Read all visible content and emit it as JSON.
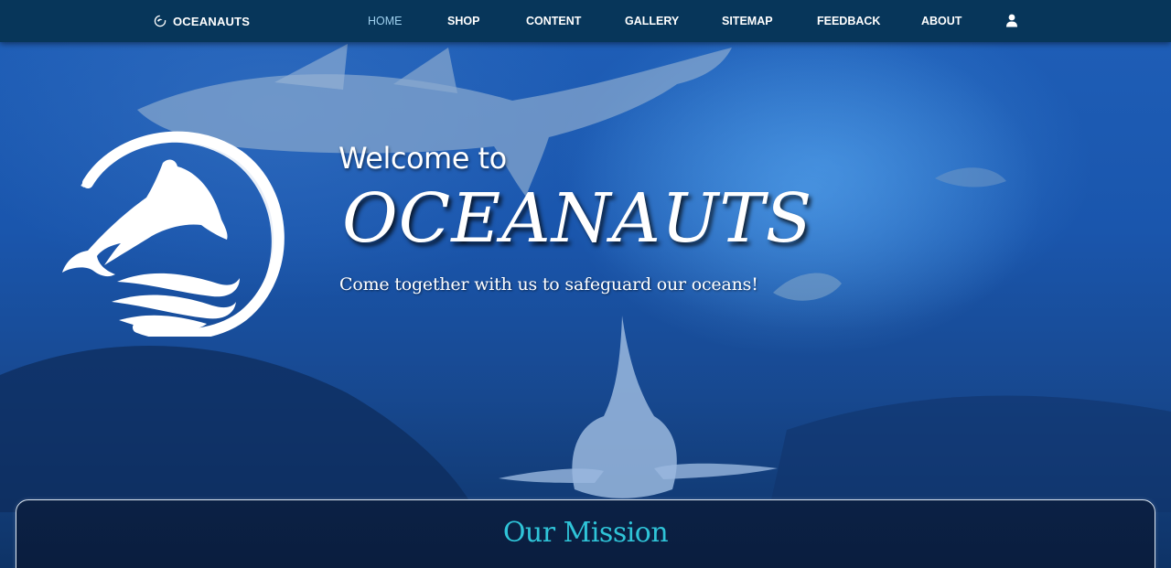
{
  "brand": {
    "name": "OCEANAUTS",
    "icon": "dolphin-logo-icon"
  },
  "nav": {
    "items": [
      {
        "label": "HOME",
        "active": true
      },
      {
        "label": "SHOP",
        "active": false
      },
      {
        "label": "CONTENT",
        "active": false
      },
      {
        "label": "GALLERY",
        "active": false
      },
      {
        "label": "SITEMAP",
        "active": false
      },
      {
        "label": "FEEDBACK",
        "active": false
      },
      {
        "label": "ABOUT",
        "active": false
      }
    ],
    "account_icon": "user-icon"
  },
  "hero": {
    "welcome": "Welcome to",
    "title": "OCEANAUTS",
    "tagline": "Come together with us to safeguard our oceans!",
    "logo_icon": "dolphin-circle-logo"
  },
  "mission": {
    "title": "Our Mission"
  },
  "colors": {
    "navbar": "#07365a",
    "active_nav": "#9fd0ee",
    "mission_title": "#2fc4d8",
    "ocean": "#1a56ad"
  }
}
